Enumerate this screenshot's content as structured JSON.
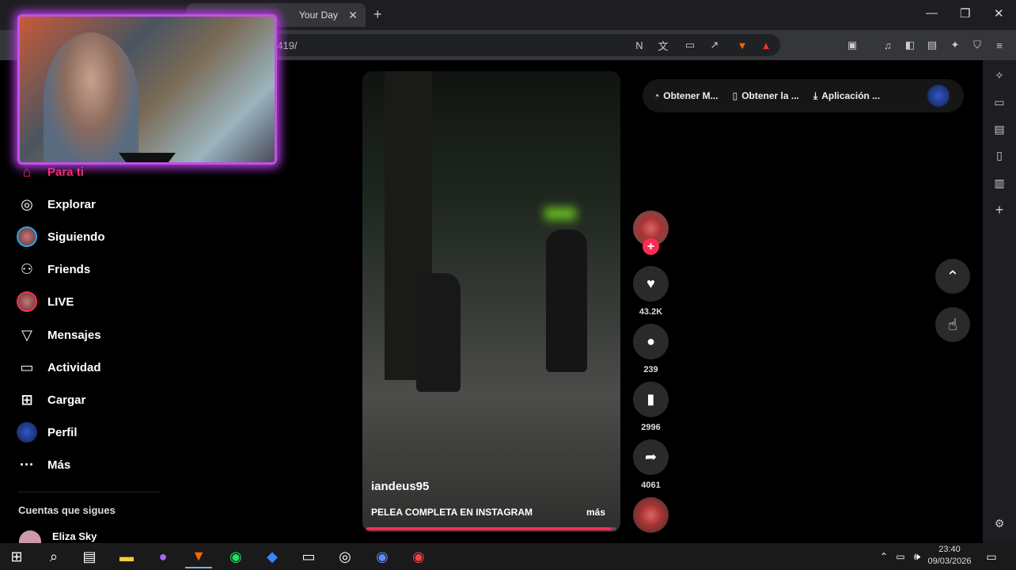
{
  "browser": {
    "active_tab_title": "Your Day",
    "url_fragment": "-419/"
  },
  "sidebar": {
    "items": [
      {
        "label": "Para ti",
        "icon": "home-icon"
      },
      {
        "label": "Explorar",
        "icon": "compass-icon"
      },
      {
        "label": "Siguiendo",
        "icon": "following-avatar-icon"
      },
      {
        "label": "Friends",
        "icon": "friends-icon"
      },
      {
        "label": "LIVE",
        "icon": "live-icon"
      },
      {
        "label": "Mensajes",
        "icon": "send-icon"
      },
      {
        "label": "Actividad",
        "icon": "activity-icon"
      },
      {
        "label": "Cargar",
        "icon": "upload-icon"
      },
      {
        "label": "Perfil",
        "icon": "profile-icon"
      },
      {
        "label": "Más",
        "icon": "more-icon"
      }
    ],
    "following_heading": "Cuentas que sigues",
    "following_first": "Eliza Sky"
  },
  "top_pill": {
    "item1": "Obtener M...",
    "item2": "Obtener la ...",
    "item3": "Aplicación ..."
  },
  "video": {
    "username": "iandeus95",
    "caption": "PELEA COMPLETA EN INSTAGRAM",
    "more_label": "más",
    "progress": 0.98
  },
  "actions": {
    "likes": "43.2K",
    "comments": "239",
    "saves": "2996",
    "shares": "4061"
  },
  "taskbar": {
    "time": "23:40",
    "date": "09/03/2026"
  },
  "colors": {
    "accent": "#fe2c55",
    "webcam_frame": "#c64fe8"
  }
}
